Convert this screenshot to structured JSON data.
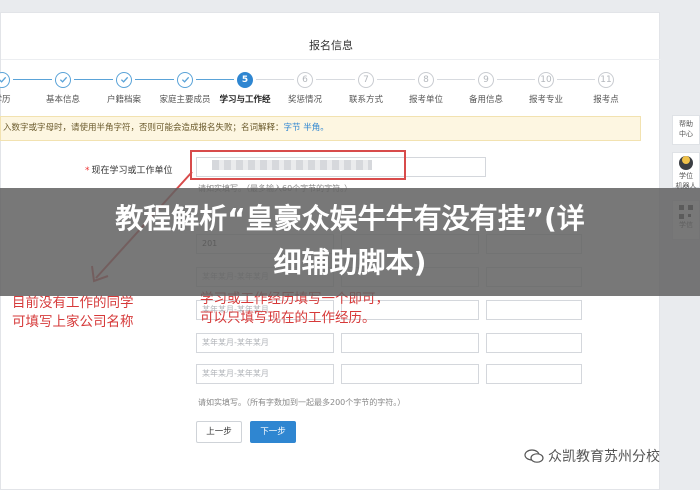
{
  "card_title": "报名信息",
  "steps": [
    {
      "num": "",
      "label": "学历",
      "state": "done"
    },
    {
      "num": "",
      "label": "基本信息",
      "state": "done"
    },
    {
      "num": "",
      "label": "户籍档案",
      "state": "done"
    },
    {
      "num": "",
      "label": "家庭主要成员",
      "state": "done"
    },
    {
      "num": "5",
      "label": "学习与工作经",
      "state": "active"
    },
    {
      "num": "6",
      "label": "奖惩情况",
      "state": "todo"
    },
    {
      "num": "7",
      "label": "联系方式",
      "state": "todo"
    },
    {
      "num": "8",
      "label": "报考单位",
      "state": "todo"
    },
    {
      "num": "9",
      "label": "备用信息",
      "state": "todo"
    },
    {
      "num": "10",
      "label": "报考专业",
      "state": "todo"
    },
    {
      "num": "11",
      "label": "报考点",
      "state": "todo"
    }
  ],
  "notice": {
    "text": "入数字或字母时，请使用半角字符，否则可能会造成报名失败；名词解释：",
    "link": "字节 半角。"
  },
  "form": {
    "current_unit_label": "现在学习或工作单位",
    "current_unit_hint": "请如实填写。（最多输入60个字节的字符。）",
    "period_value": "201",
    "period_placeholder": "某年某月-某年某月",
    "history_hint": "请如实填写。（所有字数加到一起最多200个字节的字符。）",
    "prev_button": "上一步",
    "next_button": "下一步"
  },
  "annotations": {
    "left_note_line1": "目前没有工作的同学",
    "left_note_line2": "可填写上家公司名称",
    "right_note_line1": "学习或工作经历填写一个即可，",
    "right_note_line2": "可以只填写现在的工作经历。"
  },
  "side": {
    "help_line1": "帮助",
    "help_line2": "中心",
    "face_line1": "学位",
    "face_line2": "机器人",
    "qr_line1": "学信"
  },
  "banner": {
    "line1": "教程解析“皇豪众娱牛牛有没有挂”(详",
    "line2": "细辅助脚本)"
  },
  "watermark": "众凯教育苏州分校",
  "colors": {
    "accent": "#2f86d1",
    "annotation_red": "#d63a3a"
  }
}
